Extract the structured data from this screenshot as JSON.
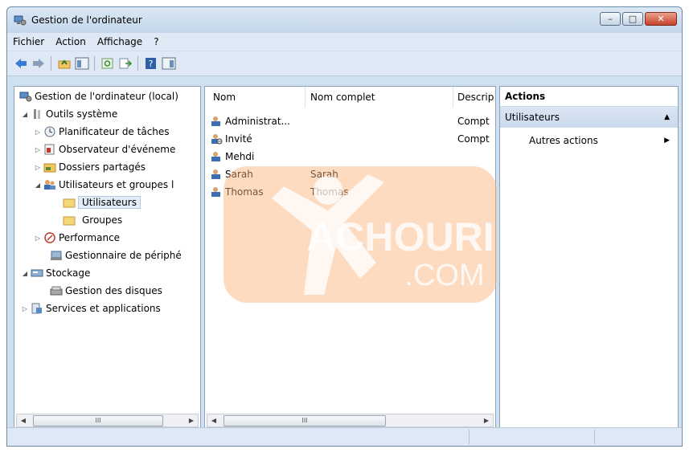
{
  "window": {
    "title": "Gestion de l'ordinateur"
  },
  "menubar": [
    "Fichier",
    "Action",
    "Affichage",
    "?"
  ],
  "tree": {
    "root": "Gestion de l'ordinateur (local)",
    "outils": "Outils système",
    "planificateur": "Planificateur de tâches",
    "observateur": "Observateur d'événeme",
    "dossiers": "Dossiers partagés",
    "utilisateurs_groupes": "Utilisateurs et groupes l",
    "utilisateurs": "Utilisateurs",
    "groupes": "Groupes",
    "performance": "Performance",
    "gestionnaire": "Gestionnaire de périphé",
    "stockage": "Stockage",
    "disques": "Gestion des disques",
    "services": "Services et applications"
  },
  "list": {
    "columns": [
      "Nom",
      "Nom complet",
      "Descrip"
    ],
    "rows": [
      {
        "name": "Administrat...",
        "fullname": "",
        "desc": "Compt"
      },
      {
        "name": "Invité",
        "fullname": "",
        "desc": "Compt"
      },
      {
        "name": "Mehdi",
        "fullname": "",
        "desc": ""
      },
      {
        "name": "Sarah",
        "fullname": "Sarah",
        "desc": ""
      },
      {
        "name": "Thomas",
        "fullname": "Thomas",
        "desc": ""
      }
    ]
  },
  "actions": {
    "header": "Actions",
    "section": "Utilisateurs",
    "item": "Autres actions"
  },
  "scroll": {
    "thumb_glyph": "III"
  },
  "watermark": {
    "brand": "ACHOURI",
    "suffix": ".COM",
    "color": "#f4a15a"
  }
}
